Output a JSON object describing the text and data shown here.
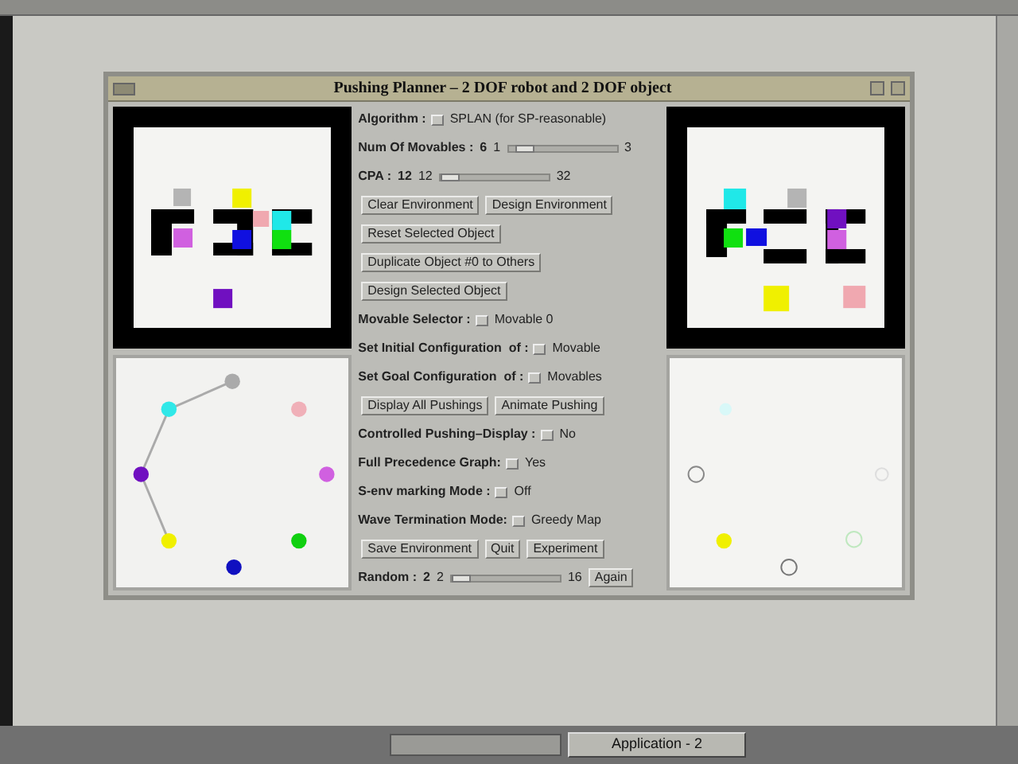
{
  "window": {
    "title": "Pushing Planner – 2 DOF robot and 2 DOF object"
  },
  "controls": [
    {
      "kind": "option",
      "label": "Algorithm :",
      "value": "SPLAN (for SP-reasonable)"
    },
    {
      "kind": "slider",
      "label": "Num Of Movables :",
      "value": "6",
      "min": "1",
      "max": "3",
      "level": 0.08
    },
    {
      "kind": "slider",
      "label": "CPA :",
      "value": "12",
      "min": "12",
      "max": "32",
      "level": 0.0
    },
    {
      "kind": "buttons",
      "buttons": [
        "Clear Environment",
        "Design Environment"
      ]
    },
    {
      "kind": "buttons",
      "buttons": [
        "Reset Selected Object"
      ]
    },
    {
      "kind": "buttons",
      "buttons": [
        "Duplicate Object #0 to Others"
      ]
    },
    {
      "kind": "buttons",
      "buttons": [
        "Design Selected Object"
      ]
    },
    {
      "kind": "option",
      "label": "Movable Selector :",
      "value": "Movable 0"
    },
    {
      "kind": "option",
      "label": "Set Initial Configuration  of :",
      "value": "Movable"
    },
    {
      "kind": "option",
      "label": "Set Goal Configuration  of :",
      "value": "Movables"
    },
    {
      "kind": "buttons",
      "buttons": [
        "Display All Pushings",
        "Animate Pushing"
      ]
    },
    {
      "kind": "option",
      "label": "Controlled Pushing–Display :",
      "value": "No"
    },
    {
      "kind": "option",
      "label": "Full Precedence Graph:",
      "value": "Yes"
    },
    {
      "kind": "option",
      "label": "S-env marking Mode :",
      "value": "Off"
    },
    {
      "kind": "option",
      "label": "Wave Termination Mode:",
      "value": "Greedy Map"
    },
    {
      "kind": "buttons",
      "buttons": [
        "Save Environment",
        "Quit",
        "Experiment"
      ]
    },
    {
      "kind": "slider",
      "label": "Random :",
      "value": "2",
      "min": "2",
      "max": "16",
      "level": 0.0,
      "button": "Again"
    }
  ],
  "taskbar": {
    "button": "Application - 2"
  }
}
